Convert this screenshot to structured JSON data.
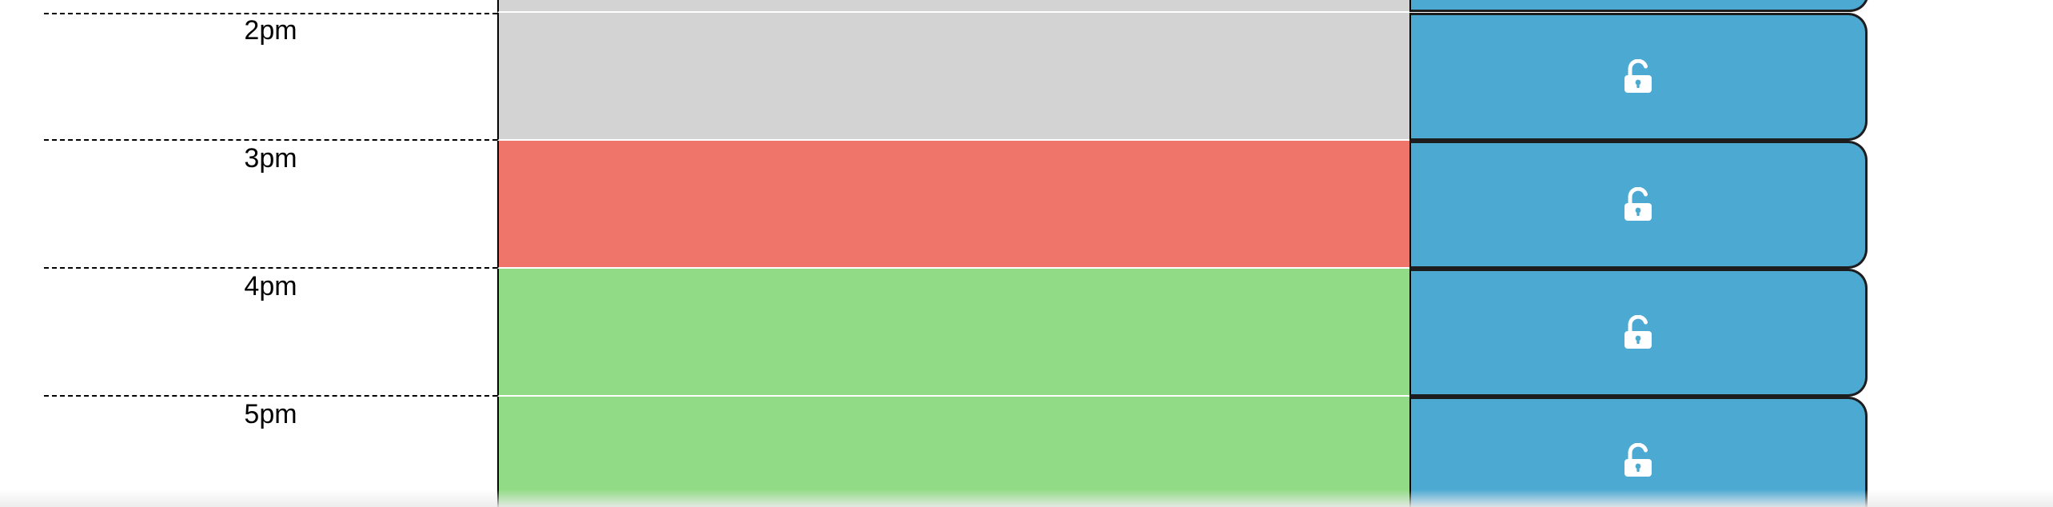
{
  "colors": {
    "past": "#d3d3d3",
    "present": "#ef746a",
    "future": "#92db86",
    "save_button": "#4ba9d2"
  },
  "top_partial_row": {
    "state": "past"
  },
  "timeblocks": [
    {
      "hour_label": "2pm",
      "state": "past",
      "description": "",
      "save_icon": "unlock-icon"
    },
    {
      "hour_label": "3pm",
      "state": "present",
      "description": "",
      "save_icon": "unlock-icon"
    },
    {
      "hour_label": "4pm",
      "state": "future",
      "description": "",
      "save_icon": "unlock-icon"
    },
    {
      "hour_label": "5pm",
      "state": "future",
      "description": "",
      "save_icon": "unlock-icon"
    }
  ]
}
